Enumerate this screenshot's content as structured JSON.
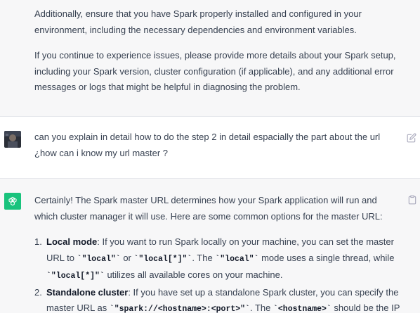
{
  "assistant_prev": {
    "paragraphs": [
      "Additionally, ensure that you have Spark properly installed and configured in your environment, including the necessary dependencies and environment variables.",
      "If you continue to experience issues, please provide more details about your Spark setup, including your Spark version, cluster configuration (if applicable), and any additional error messages or logs that might be helpful in diagnosing the problem."
    ]
  },
  "user_message": {
    "text": "can you explain in detail how to do the step 2 in detail espacially the part about the url ¿how can i know my url master ?"
  },
  "assistant_reply": {
    "intro": "Certainly! The Spark master URL determines how your Spark application will run and which cluster manager it will use. Here are some common options for the master URL:",
    "items": [
      {
        "num": "1.",
        "title": "Local mode",
        "t1": ": If you want to run Spark locally on your machine, you can set the master URL to ",
        "c1": "`\"local\"`",
        "t2": " or ",
        "c2": "`\"local[*]\"`",
        "t3": ". The ",
        "c3": "`\"local\"`",
        "t4": " mode uses a single thread, while ",
        "c4": "`\"local[*]\"`",
        "t5": " utilizes all available cores on your machine."
      },
      {
        "num": "2.",
        "title": "Standalone cluster",
        "t1": ": If you have set up a standalone Spark cluster, you can specify the master URL as ",
        "c1": "`\"spark://<hostname>:<port>\"`",
        "t2": ". The ",
        "c2": "`<hostname>`",
        "t3": " should be the IP"
      }
    ]
  },
  "colors": {
    "assistant_bg": "#f7f7f8",
    "gpt_green": "#19c37d",
    "text": "#374151"
  },
  "icons": [
    "edit-icon",
    "copy-icon",
    "openai-logo-icon",
    "user-avatar"
  ]
}
